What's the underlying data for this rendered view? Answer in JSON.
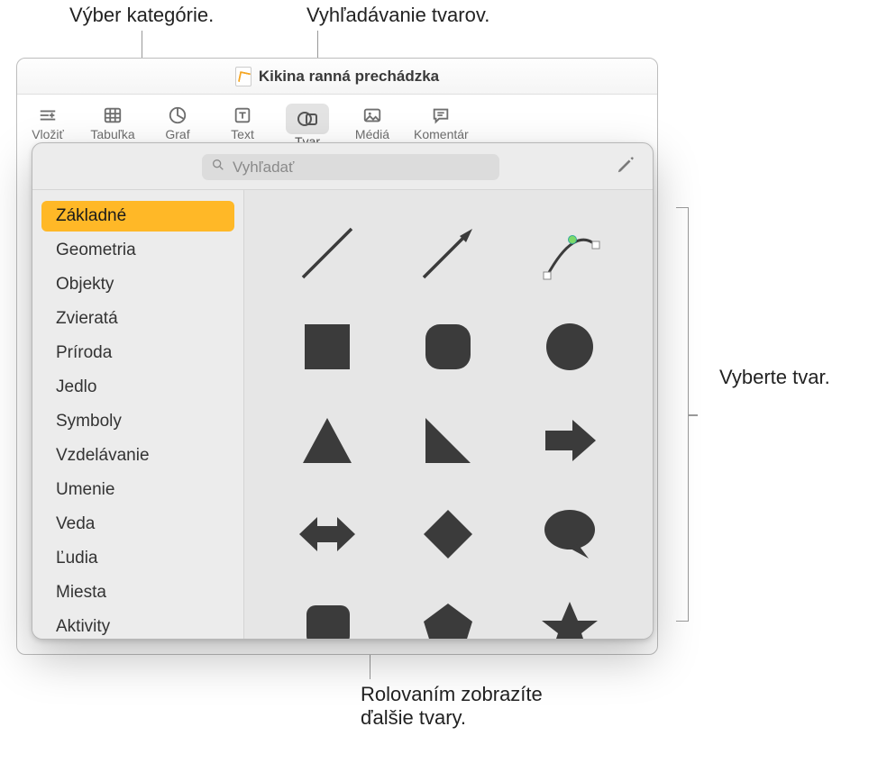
{
  "callouts": {
    "category": "Výber kategórie.",
    "search": "Vyhľadávanie tvarov.",
    "choose": "Vyberte tvar.",
    "scroll": "Rolovaním zobrazíte\nďalšie tvary."
  },
  "title": "Kikina ranná prechádzka",
  "toolbar": {
    "insert": "Vložiť",
    "table": "Tabuľka",
    "chart": "Graf",
    "text": "Text",
    "shape": "Tvar",
    "media": "Médiá",
    "comment": "Komentár"
  },
  "search": {
    "placeholder": "Vyhľadať",
    "value": ""
  },
  "categories": [
    "Základné",
    "Geometria",
    "Objekty",
    "Zvieratá",
    "Príroda",
    "Jedlo",
    "Symboly",
    "Vzdelávanie",
    "Umenie",
    "Veda",
    "Ľudia",
    "Miesta",
    "Aktivity"
  ],
  "selected_category_index": 0,
  "shapes": [
    "line",
    "arrow-line",
    "curve",
    "square",
    "rounded-square",
    "circle",
    "triangle",
    "right-triangle",
    "arrow-right",
    "double-arrow",
    "diamond",
    "speech-bubble",
    "callout-box",
    "pentagon",
    "star"
  ]
}
